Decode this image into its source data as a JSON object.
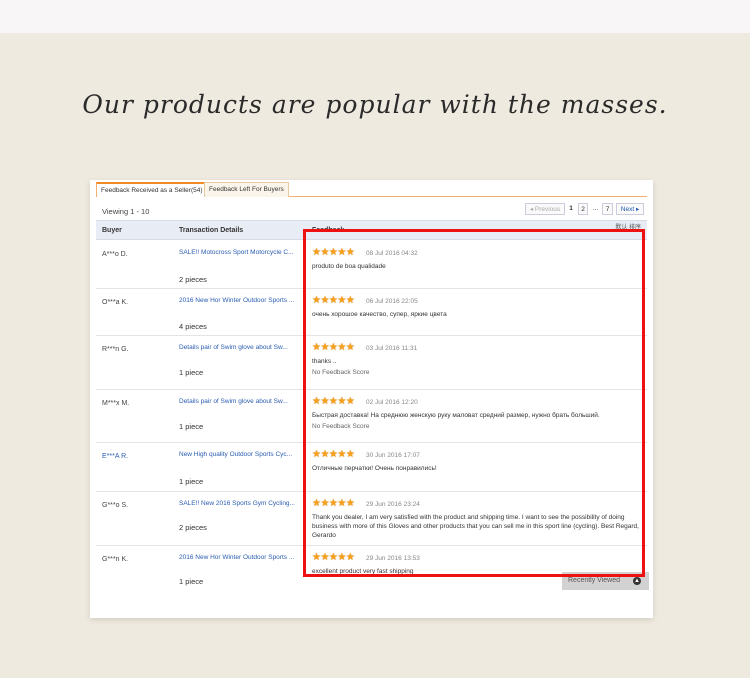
{
  "headline": "Our products are popular with the masses.",
  "tabs": [
    {
      "label": "Feedback Received as a Seller(54)"
    },
    {
      "label": "Feedback Left For Buyers"
    }
  ],
  "viewing": "Viewing 1 - 10",
  "pagination": {
    "previous": "◂ Previous",
    "page1": "1",
    "page2": "2",
    "ellipsis": "...",
    "page7": "7",
    "next": "Next ▸"
  },
  "columns": {
    "buyer": "Buyer",
    "transaction": "Transaction Details",
    "feedback": "Feedback",
    "clipped_label": "默认 排序"
  },
  "rows": [
    {
      "buyer": "A***o D.",
      "product": "SALE!! Motocross Sport Motorcycle C...",
      "pieces": "2 pieces",
      "stars": "★★★★★",
      "date": "08 Jul 2016 04:32",
      "comment": "produto de boa qualidade",
      "note": ""
    },
    {
      "buyer": "O***a K.",
      "product": "2016 New Hor Winter Outdoor Sports ...",
      "pieces": "4 pieces",
      "stars": "★★★★★",
      "date": "06 Jul 2016 22:05",
      "comment": "очень хорошое качество, супер, яркие цвета",
      "note": ""
    },
    {
      "buyer": "R***n G.",
      "product": "Details pair of Swim glove about Sw...",
      "pieces": "1 piece",
      "stars": "★★★★★",
      "date": "03 Jul 2016 11:31",
      "comment": "thanks ..",
      "note": "No Feedback Score"
    },
    {
      "buyer": "M***x M.",
      "product": "Details pair of Swim glove about Sw...",
      "pieces": "1 piece",
      "stars": "★★★★★",
      "date": "02 Jul 2016 12:20",
      "comment": "Быстрая доставка! На среднюю женскую руку маловат средний размер, нужно брать больший.",
      "note": "No Feedback Score"
    },
    {
      "buyer": "E***A R.",
      "product": "New High quality Outdoor Sports Cyc...",
      "pieces": "1 piece",
      "stars": "★★★★★",
      "date": "30 Jun 2016 17:07",
      "comment": "Отличные перчатки! Очень понравились!",
      "note": ""
    },
    {
      "buyer": "G***o S.",
      "product": "SALE!! New 2016 Sports Gym Cycling...",
      "pieces": "2 pieces",
      "stars": "★★★★★",
      "date": "29 Jun 2016 23:24",
      "comment": "Thank you dealer, I am very satisfied with the product and shipping time. I want to see the possibility of doing business with more of this Gloves and other products that you can sell me in this sport line (cycling). Best Regard, Gerardo",
      "note": ""
    },
    {
      "buyer": "G***n K.",
      "product": "2016 New Hor Winter Outdoor Sports ...",
      "pieces": "1 piece",
      "stars": "★★★★★",
      "date": "29 Jun 2016 13:53",
      "comment": "excellent product very fast shipping",
      "note": ""
    }
  ],
  "recently_viewed": "Recently Viewed",
  "colors": {
    "accent_star": "#f7a11a",
    "link": "#2a5db0",
    "highlight_border": "#ee1111"
  }
}
